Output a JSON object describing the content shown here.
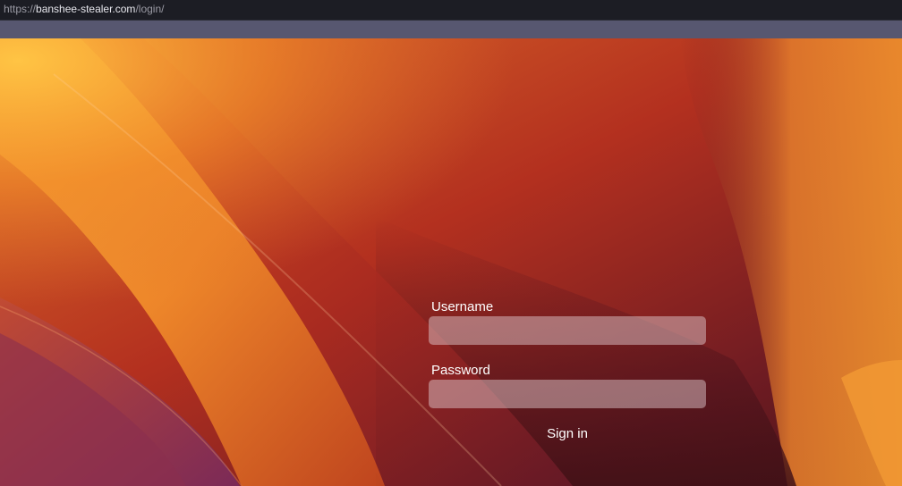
{
  "browser": {
    "url_scheme": "https://",
    "url_host": "banshee-stealer.com",
    "url_path": "/login/"
  },
  "login": {
    "username_label": "Username",
    "username_value": "",
    "password_label": "Password",
    "password_value": "",
    "submit_label": "Sign in"
  },
  "colors": {
    "wallpaper_orange": "#f08a2a",
    "wallpaper_red": "#b8321f",
    "wallpaper_dark": "#4a1418",
    "wallpaper_purple": "#7a2a5a"
  }
}
